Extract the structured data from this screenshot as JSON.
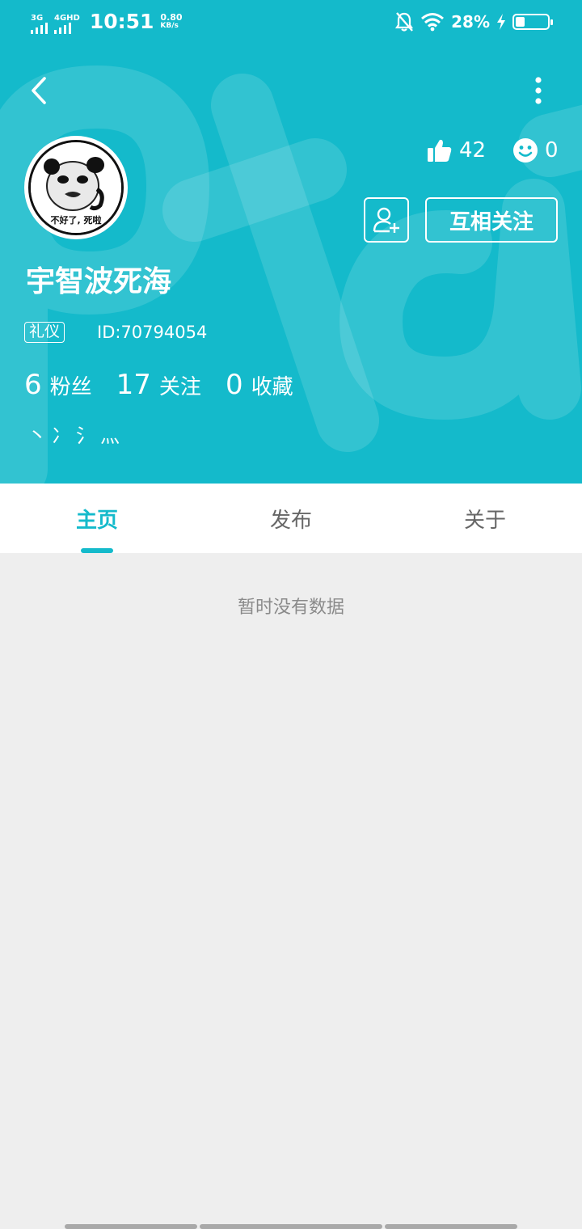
{
  "status_bar": {
    "signal1_label": "3G",
    "signal2_label": "4GHD",
    "time": "10:51",
    "speed_value": "0.80",
    "speed_unit": "KB/s",
    "battery_pct": "28%",
    "battery_level": 0.28
  },
  "profile": {
    "username": "宇智波死海",
    "tag": "礼仪",
    "id_text": "ID:70794054",
    "likes": "42",
    "smiles": "0",
    "mutual_follow_label": "互相关注",
    "avatar_caption": "不好了, 死啦",
    "bio": "丶冫氵灬",
    "counts": [
      {
        "num": "6",
        "label": "粉丝"
      },
      {
        "num": "17",
        "label": "关注"
      },
      {
        "num": "0",
        "label": "收藏"
      }
    ]
  },
  "tabs": [
    {
      "label": "主页",
      "active": true
    },
    {
      "label": "发布",
      "active": false
    },
    {
      "label": "关于",
      "active": false
    }
  ],
  "empty_text": "暂时没有数据",
  "colors": {
    "accent": "#14bacb",
    "page_bg": "#eeeeee",
    "tab_inactive": "#666666",
    "empty_text": "#8a8a8a"
  }
}
